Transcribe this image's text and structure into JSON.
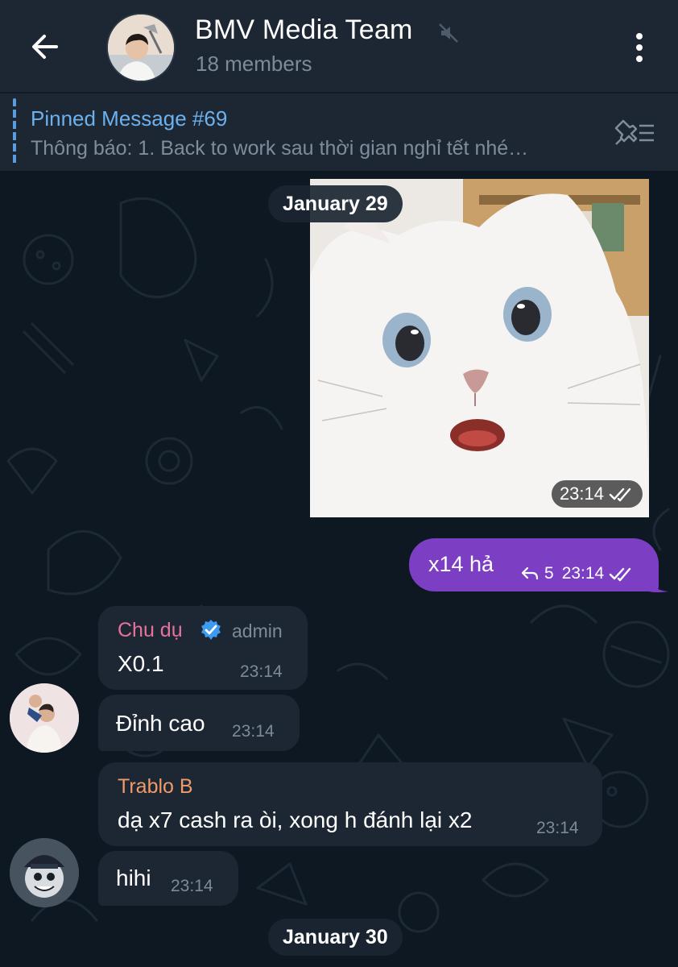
{
  "header": {
    "title": "BMV Media Team",
    "subtitle": "18 members",
    "avatar_icon": "group-avatar-photo",
    "back_icon": "arrow-left-icon",
    "mute_icon": "speaker-muted-icon",
    "more_icon": "vertical-dots-icon"
  },
  "pinned": {
    "title": "Pinned Message #69",
    "text": "Thông báo: 1. Back to work sau thời gian nghỉ tết nhé…",
    "icon": "pin-list-icon"
  },
  "chat": {
    "dates": [
      "January 29",
      "January 30"
    ],
    "photo_message": {
      "time": "23:14",
      "status_icon": "double-check-icon"
    },
    "outgoing": {
      "text": "x14 hả",
      "reply_count": "5",
      "time": "23:14"
    },
    "group1": {
      "sender": "Chu dụ",
      "role": "admin",
      "verified_icon": "verified-badge-icon",
      "messages": [
        {
          "text": "X0.1",
          "time": "23:14"
        },
        {
          "text": "Đỉnh cao",
          "time": "23:14"
        }
      ]
    },
    "group2": {
      "sender": "Trablo B",
      "messages": [
        {
          "text": "dạ x7 cash ra òi, xong h đánh lại x2",
          "time": "23:14"
        },
        {
          "text": "hihi",
          "time": "23:14"
        }
      ]
    }
  },
  "colors": {
    "header_bg": "#1d2733",
    "chat_bg": "#0e1822",
    "outgoing_bubble": "#7c3fc4",
    "incoming_bubble": "#1d2733",
    "link_blue": "#6cb1ed",
    "sender1": "#e5739b",
    "sender2": "#f09a6a",
    "verified": "#3c9bf0"
  }
}
